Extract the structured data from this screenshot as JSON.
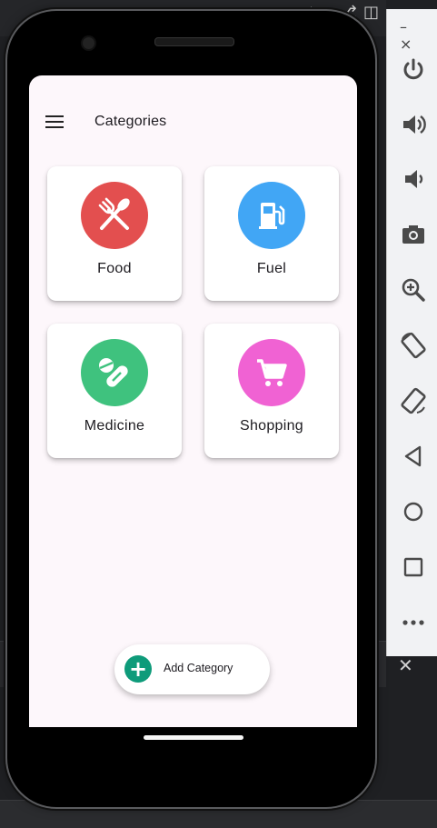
{
  "app": {
    "title": "Categories",
    "categories": [
      {
        "label": "Food",
        "icon": "utensils-icon",
        "color": "#e34f4f"
      },
      {
        "label": "Fuel",
        "icon": "fuel-pump-icon",
        "color": "#41a6f5"
      },
      {
        "label": "Medicine",
        "icon": "pills-icon",
        "color": "#3fc27e"
      },
      {
        "label": "Shopping",
        "icon": "shopping-cart-icon",
        "color": "#f062d3"
      }
    ],
    "add_button": {
      "label": "Add Category",
      "icon": "plus-icon",
      "color": "#0e9b7a"
    }
  },
  "emulator": {
    "minimize_label": "–",
    "close_label": "×",
    "buttons": [
      "power-icon",
      "volume-up-icon",
      "volume-down-icon",
      "camera-icon",
      "zoom-icon",
      "rotate-left-icon",
      "rotate-right-icon",
      "back-icon",
      "home-icon",
      "overview-icon",
      "more-icon"
    ]
  },
  "background": {
    "close_label": "✕"
  }
}
